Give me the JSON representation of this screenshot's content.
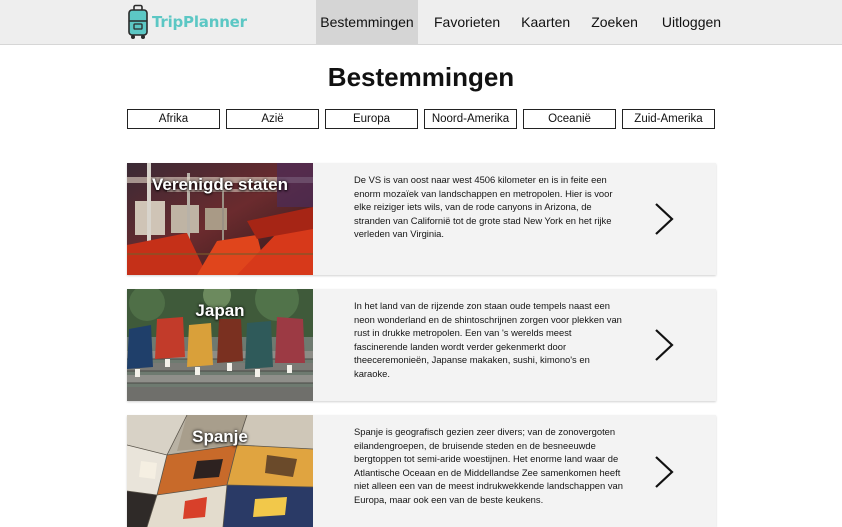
{
  "app": {
    "name": "TripPlanner",
    "brand_color": "#5cc7c4"
  },
  "nav": {
    "items": [
      "Bestemmingen",
      "Favorieten",
      "Kaarten",
      "Zoeken",
      "Uitloggen"
    ],
    "active": "Bestemmingen"
  },
  "page": {
    "title": "Bestemmingen"
  },
  "filters": [
    "Afrika",
    "Azië",
    "Europa",
    "Noord-Amerika",
    "Oceanië",
    "Zuid-Amerika"
  ],
  "destinations": [
    {
      "title": "Verenigde staten",
      "description": "De VS is van oost naar west 4506 kilometer en is in feite een enorm mozaïek van landschappen en metropolen. Hier is voor elke reiziger iets wils, van de rode canyons in Arizona, de stranden van Californië tot de grote stad New York en het rijke verleden van Virginia.",
      "image": "subway-car-photo"
    },
    {
      "title": "Japan",
      "description": "In het land van de rijzende zon staan oude tempels naast een neon wonderland en de shintoschrijnen zorgen voor plekken van rust in drukke metropolen. Een van 's werelds meest fascinerende landen wordt verder gekenmerkt door theeceremonieën, Japanse makaken, sushi, kimono's en karaoke.",
      "image": "kimono-steps-photo"
    },
    {
      "title": "Spanje",
      "description": "Spanje is geografisch gezien zeer divers; van de zonovergoten eilandengroepen, de bruisende steden en de besneeuwde bergtoppen tot semi-aride woestijnen. Het enorme land waar de Atlantische Oceaan en de Middellandse Zee samenkomen heeft niet alleen een van de meest indrukwekkende landschappen van Europa, maar ook een van de beste keukens.",
      "image": "mosaic-photo"
    }
  ],
  "icons": {
    "logo": "suitcase-icon",
    "card_arrow": "chevron-right-icon"
  }
}
